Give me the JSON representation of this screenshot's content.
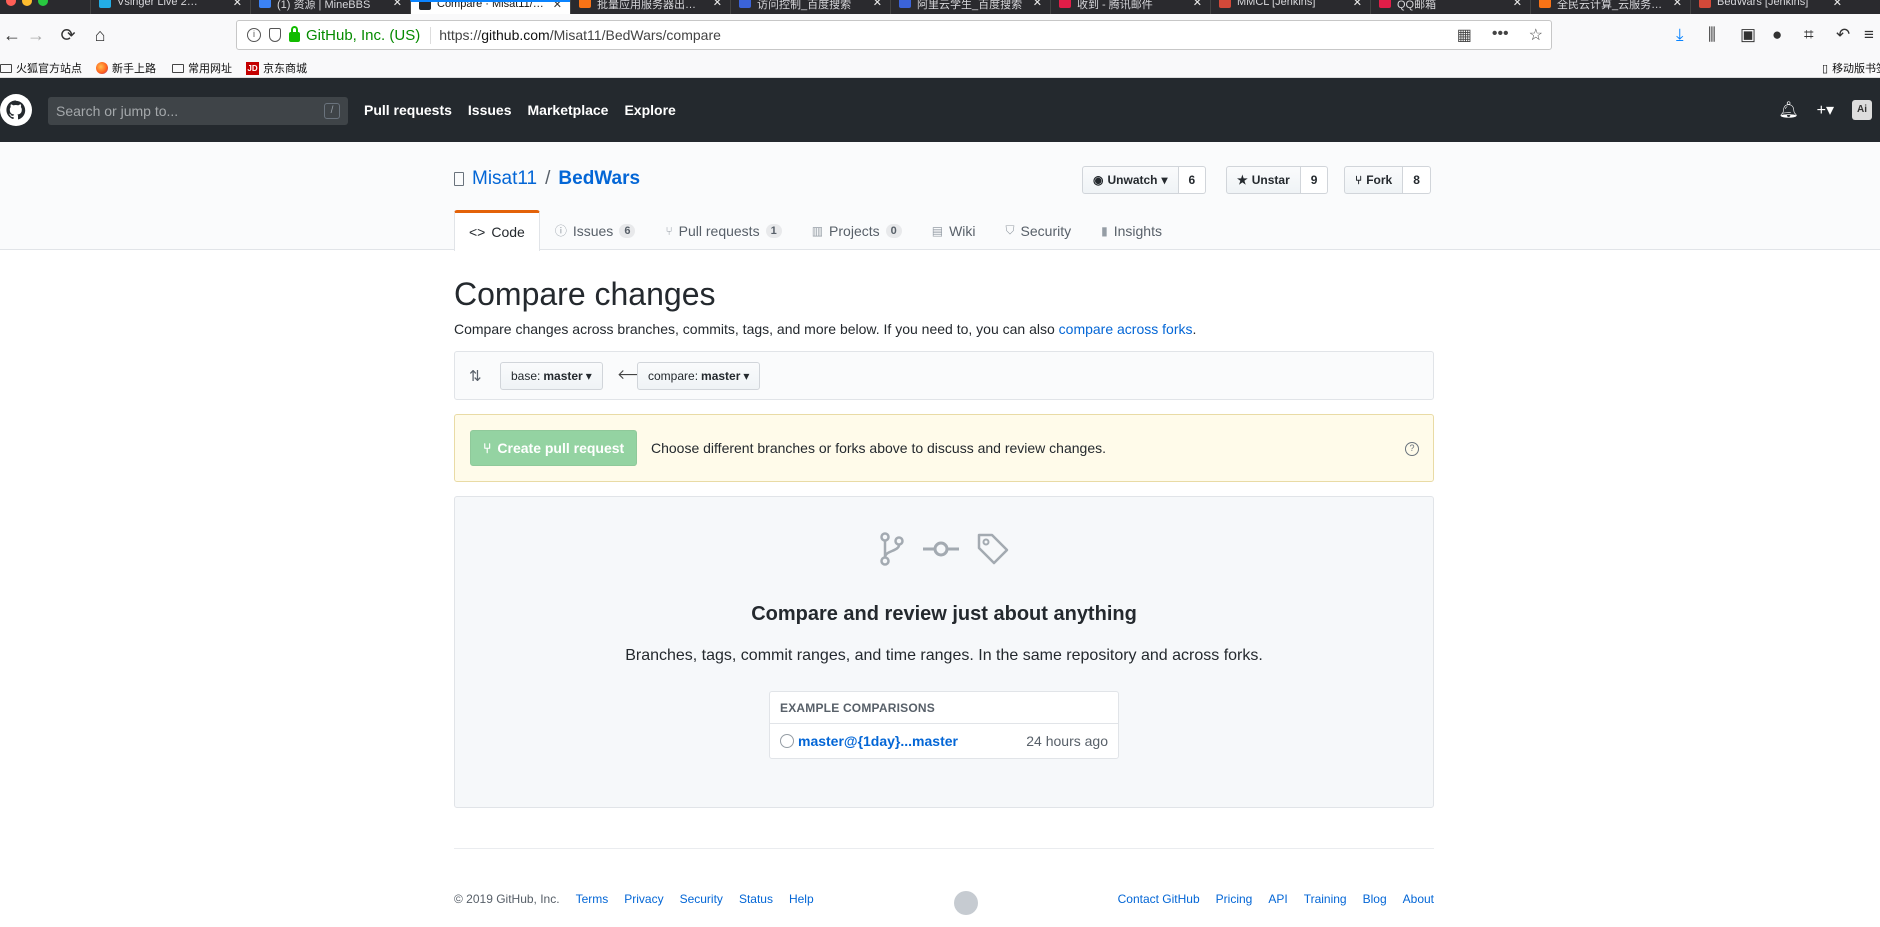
{
  "browser": {
    "tabs": [
      {
        "title": "Vsinger Live 2…",
        "icon_color": "#23ade5"
      },
      {
        "title": "(1) 资源 | MineBBS",
        "icon_color": "#3b82f6"
      },
      {
        "title": "Compare · Misat11/…",
        "icon_color": "#24292e",
        "active": true
      },
      {
        "title": "批量应用服务器出…",
        "icon_color": "#f97316"
      },
      {
        "title": "访问控制_百度搜索",
        "icon_color": "#3b63d9"
      },
      {
        "title": "阿里云学生_百度搜索",
        "icon_color": "#3b63d9"
      },
      {
        "title": "收到 - 腾讯邮件",
        "icon_color": "#e11d48"
      },
      {
        "title": "MMCL [Jenkins]",
        "icon_color": "#d24939"
      },
      {
        "title": "QQ邮箱",
        "icon_color": "#e11d48"
      },
      {
        "title": "全民云计算_云服务…",
        "icon_color": "#f97316"
      },
      {
        "title": "BedWars [Jenkins]",
        "icon_color": "#d24939"
      }
    ],
    "org_label": "GitHub, Inc. (US)",
    "url_prefix": "https://",
    "url_host": "github.com",
    "url_path": "/Misat11/BedWars/compare",
    "bookmarks": [
      "火狐官方站点",
      "新手上路",
      "常用网址",
      "京东商城"
    ],
    "mobile_bookmarks": "移动版书签"
  },
  "header": {
    "search_placeholder": "Search or jump to...",
    "slash": "/",
    "nav": [
      "Pull requests",
      "Issues",
      "Marketplace",
      "Explore"
    ]
  },
  "repo": {
    "owner": "Misat11",
    "separator": "/",
    "name": "BedWars",
    "watch_label": "Unwatch",
    "watch_count": "6",
    "star_label": "Unstar",
    "star_count": "9",
    "fork_label": "Fork",
    "fork_count": "8",
    "tabs": [
      {
        "label": "Code",
        "icon": "code-icon"
      },
      {
        "label": "Issues",
        "count": "6",
        "icon": "issue-icon"
      },
      {
        "label": "Pull requests",
        "count": "1",
        "icon": "pull-request-icon"
      },
      {
        "label": "Projects",
        "count": "0",
        "icon": "project-icon"
      },
      {
        "label": "Wiki",
        "icon": "book-icon"
      },
      {
        "label": "Security",
        "icon": "shield-icon"
      },
      {
        "label": "Insights",
        "icon": "graph-icon"
      }
    ]
  },
  "compare": {
    "title": "Compare changes",
    "lead_text": "Compare changes across branches, commits, tags, and more below. If you need to, you can also ",
    "lead_link": "compare across forks",
    "lead_end": ".",
    "base_prefix": "base:",
    "base_value": "master",
    "compare_prefix": "compare:",
    "compare_value": "master",
    "create_pr_label": "Create pull request",
    "flash_text": "Choose different branches or forks above to discuss and review changes.",
    "blank_heading": "Compare and review just about anything",
    "blank_text": "Branches, tags, commit ranges, and time ranges. In the same repository and across forks.",
    "examples_heading": "EXAMPLE COMPARISONS",
    "example_link": "master@{1day}...master",
    "example_time": "24 hours ago"
  },
  "footer": {
    "copyright": "© 2019 GitHub, Inc.",
    "left_links": [
      "Terms",
      "Privacy",
      "Security",
      "Status",
      "Help"
    ],
    "right_links": [
      "Contact GitHub",
      "Pricing",
      "API",
      "Training",
      "Blog",
      "About"
    ]
  },
  "colors": {
    "header_bg": "#24292e",
    "link": "#0366d6",
    "tab_accent": "#e36209",
    "pr_button": "#94d3a2",
    "flash_bg": "#fffbea"
  }
}
